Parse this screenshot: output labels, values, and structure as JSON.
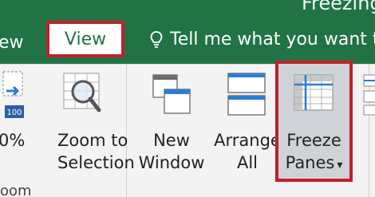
{
  "window": {
    "title_fragment": "Freezing"
  },
  "tabs": {
    "prev_tab_fragment": "ew",
    "view_label": "View",
    "tell_me_text": "Tell me what you want to"
  },
  "ribbon": {
    "zoom_fragment": "0%",
    "zoom_to_selection": {
      "line1": "Zoom to",
      "line2": "Selection"
    },
    "new_window": {
      "line1": "New",
      "line2": "Window"
    },
    "arrange_all": {
      "line1": "Arrange",
      "line2": "All"
    },
    "freeze_panes": {
      "line1": "Freeze",
      "line2": "Panes",
      "dropdown_glyph": "▾"
    },
    "group_label_fragment": "oom",
    "zoom_badge": "100"
  },
  "colors": {
    "excel_green": "#217346",
    "highlight_red": "#c0202a",
    "ribbon_bg": "#f3f3f3"
  },
  "icons": [
    "zoom-100-icon",
    "zoom-to-selection-icon",
    "new-window-icon",
    "arrange-all-icon",
    "freeze-panes-icon",
    "lightbulb-icon"
  ]
}
